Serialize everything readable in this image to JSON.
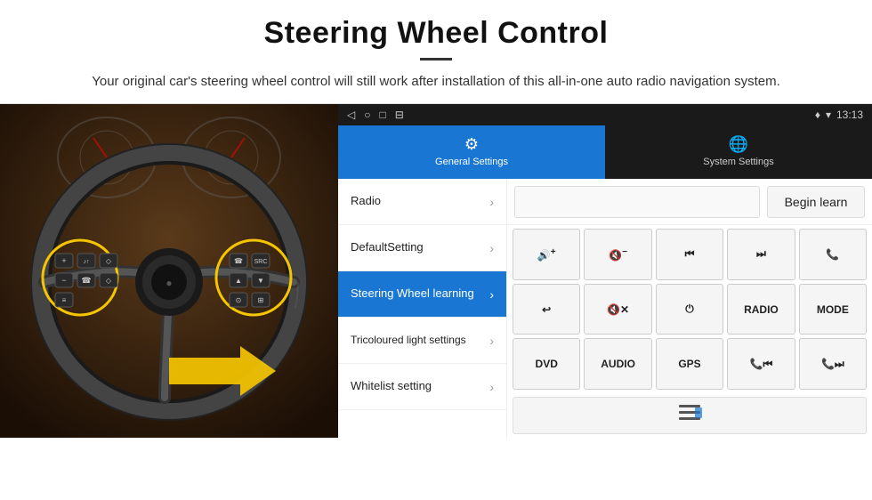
{
  "header": {
    "title": "Steering Wheel Control",
    "description": "Your original car's steering wheel control will still work after installation of this all-in-one auto radio navigation system."
  },
  "status_bar": {
    "time": "13:13",
    "nav_back": "◁",
    "nav_home": "○",
    "nav_recent": "□",
    "nav_cast": "⊟"
  },
  "tabs": [
    {
      "id": "general",
      "label": "General Settings",
      "icon": "⚙",
      "active": true
    },
    {
      "id": "system",
      "label": "System Settings",
      "icon": "🌐",
      "active": false
    }
  ],
  "menu_items": [
    {
      "id": "radio",
      "label": "Radio",
      "active": false
    },
    {
      "id": "default",
      "label": "DefaultSetting",
      "active": false
    },
    {
      "id": "steering",
      "label": "Steering Wheel learning",
      "active": true
    },
    {
      "id": "tricoloured",
      "label": "Tricoloured light settings",
      "active": false
    },
    {
      "id": "whitelist",
      "label": "Whitelist setting",
      "active": false
    }
  ],
  "begin_learn_label": "Begin learn",
  "control_buttons": {
    "row1": [
      {
        "id": "vol-up",
        "label": "🔊+",
        "type": "icon"
      },
      {
        "id": "vol-down",
        "label": "🔇-",
        "type": "icon"
      },
      {
        "id": "prev-track",
        "label": "⏮",
        "type": "icon"
      },
      {
        "id": "next-track",
        "label": "⏭",
        "type": "icon"
      },
      {
        "id": "phone",
        "label": "📞",
        "type": "icon"
      }
    ],
    "row2": [
      {
        "id": "hang-up",
        "label": "↩",
        "type": "icon"
      },
      {
        "id": "mute",
        "label": "🔇x",
        "type": "icon"
      },
      {
        "id": "power",
        "label": "⏻",
        "type": "icon"
      },
      {
        "id": "radio-btn",
        "label": "RADIO",
        "type": "text"
      },
      {
        "id": "mode-btn",
        "label": "MODE",
        "type": "text"
      }
    ],
    "row3": [
      {
        "id": "dvd-btn",
        "label": "DVD",
        "type": "text"
      },
      {
        "id": "audio-btn",
        "label": "AUDIO",
        "type": "text"
      },
      {
        "id": "gps-btn",
        "label": "GPS",
        "type": "text"
      },
      {
        "id": "tel-prev",
        "label": "📞⏮",
        "type": "icon"
      },
      {
        "id": "tel-next",
        "label": "📞⏭",
        "type": "icon"
      }
    ]
  },
  "whitelist_icon": "≡",
  "colors": {
    "active_tab": "#1976d2",
    "active_menu": "#1976d2",
    "button_bg": "#f5f5f5",
    "border": "#cccccc"
  }
}
